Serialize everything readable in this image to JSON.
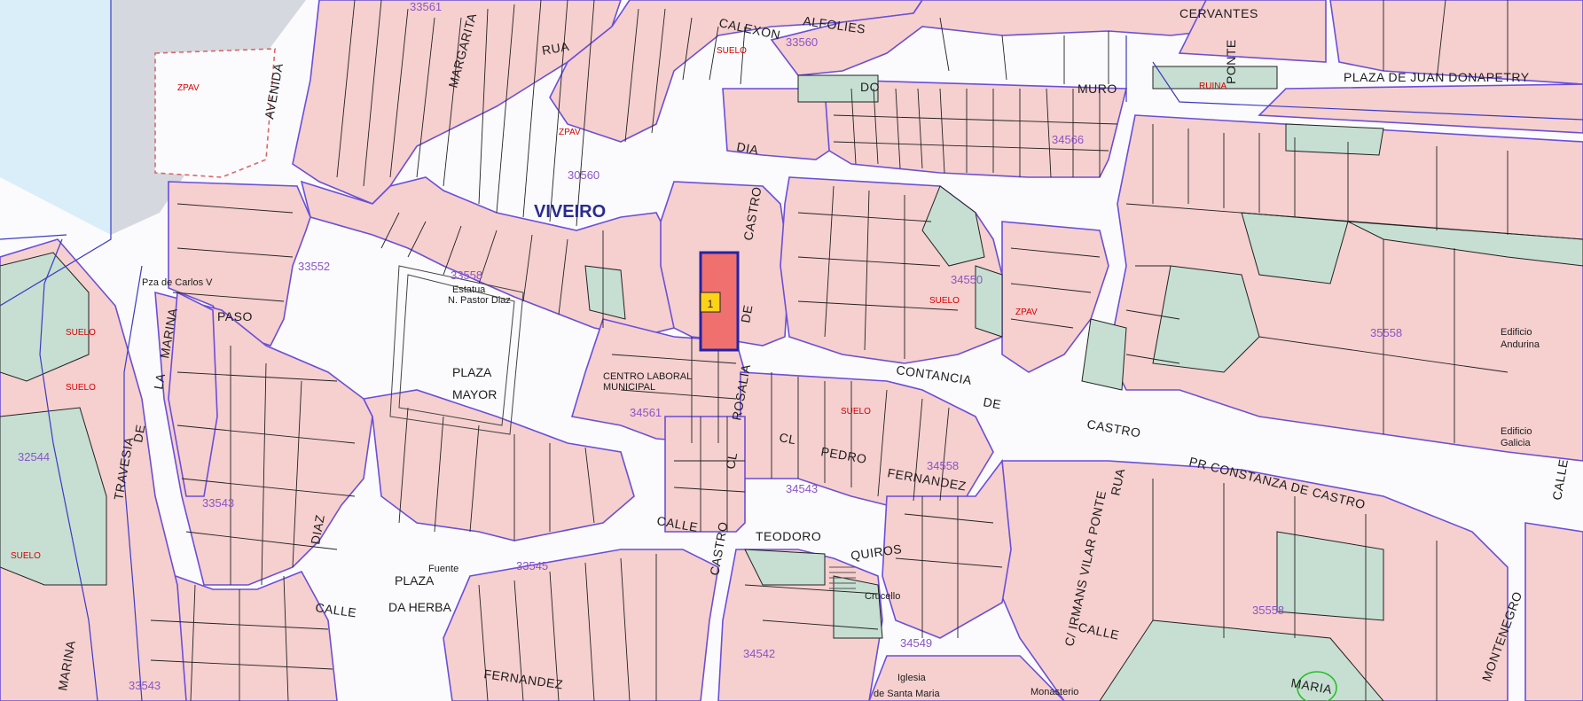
{
  "map": {
    "title": "VIVEIRO",
    "colors": {
      "block_fill": "#f6cfcf",
      "green_fill": "#c6dfd2",
      "street_outline": "#6a4fd6",
      "parcel_line": "#222222",
      "selected_parcel": "#f07070",
      "selected_outline": "#2323a8",
      "highlight_yellow": "#ffd21a",
      "water": "#d9eef8",
      "blue_text": "#1f27b8",
      "purple_text": "#8a55c7",
      "red_text": "#d60000"
    },
    "streets": {
      "cervantes": "CERVANTES",
      "plaza_donapetry": "PLAZA DE JUAN DONAPETRY",
      "rua": "RUA",
      "margarita": "MARGARITA",
      "calexon": "CALEXON",
      "alfolies": "ALFOLIES",
      "muro": "MURO",
      "do": "DO",
      "ponte": "PONTE",
      "avenida": "AVENIDA",
      "dia": "DIA",
      "castro": "CASTRO",
      "de": "DE",
      "paso": "PASO",
      "plaza_mayor_1": "PLAZA",
      "plaza_mayor_2": "MAYOR",
      "la": "LA",
      "marina": "MARINA",
      "travesia": "TRAVESIA",
      "de2": "DE",
      "constancia": "CONTANCIA",
      "de_castro": "CASTRO",
      "de3": "DE",
      "irmans": "C/ IRMANS VILAR PONTE",
      "pr_constanza": "PR CONSTANZA DE CASTRO",
      "cl_pedro": "CL",
      "pedro": "PEDRO",
      "fernandez": "FERNANDEZ",
      "teodoro": "TEODORO",
      "quiros": "QUIROS",
      "calle1": "CALLE",
      "calle2": "CALLE",
      "calle3": "CALLE",
      "calle4": "CALLE",
      "rosalia": "ROSALIA",
      "castro2": "CASTRO",
      "cl2": "CL",
      "plaza_herba_1": "PLAZA",
      "plaza_herba_2": "DA HERBA",
      "diaz": "DIAZ",
      "fernandez2": "FERNANDEZ",
      "maria": "MARIA",
      "marina2": "MARINA",
      "montenegro": "MONTENEGRO",
      "rua2": "RUA",
      "calle_right": "CALLE"
    },
    "places": {
      "pza_carlos": "Pza de Carlos V",
      "estatua_1": "Estatua",
      "estatua_2": "N. Pastor Diaz",
      "centro_laboral_1": "CENTRO LABORAL",
      "centro_laboral_2": "MUNICIPAL",
      "fuente": "Fuente",
      "crucello": "Crucello",
      "iglesia_1": "Iglesia",
      "iglesia_2": "de Santa Maria",
      "monasterio": "Monasterio",
      "edificio_andurina_1": "Edificio",
      "edificio_andurina_2": "Andurina",
      "edificio_galicia_1": "Edificio",
      "edificio_galicia_2": "Galicia"
    },
    "block_ids": {
      "b1": "33561",
      "b2": "33560",
      "b3": "30560",
      "b4": "34566",
      "b5": "33558",
      "b6": "33552",
      "b7": "34550",
      "b8": "35558",
      "b9": "34561",
      "b10": "34558",
      "b11": "32544",
      "b12": "33543",
      "b13": "33545",
      "b14": "35558",
      "b15": "33543",
      "b16": "34542",
      "b17": "34549",
      "b18": "34543"
    },
    "selected_parcel": {
      "number": "1"
    },
    "red_tags": {
      "zpav": "ZPAV",
      "suelo": "SUELO",
      "ruina": "RUINA"
    }
  }
}
